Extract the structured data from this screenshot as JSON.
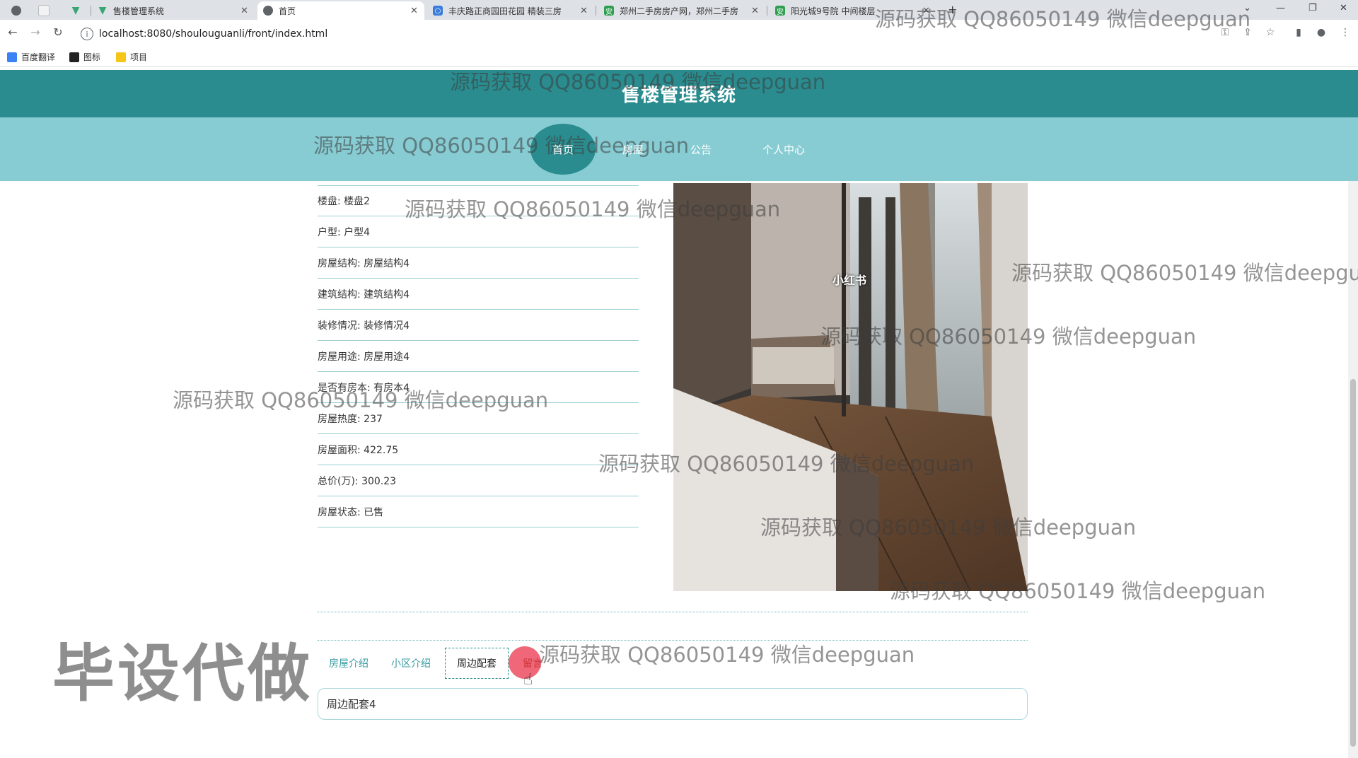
{
  "browser": {
    "tabs": [
      {
        "label": "",
        "active": false
      },
      {
        "label": "",
        "active": false
      },
      {
        "label": "售楼管理系统",
        "active": false
      },
      {
        "label": "首页",
        "active": true
      },
      {
        "label": "丰庆路正商园田花园 精装三房",
        "active": false
      },
      {
        "label": "郑州二手房房产网，郑州二手房",
        "active": false
      },
      {
        "label": "阳光城9号院 中间楼层",
        "active": false
      }
    ],
    "url": "localhost:8080/shoulouguanli/front/index.html",
    "bookmarks": [
      "百度翻译",
      "图标",
      "项目"
    ]
  },
  "site": {
    "title": "售楼管理系统",
    "nav": [
      "首页",
      "房屋",
      "公告",
      "个人中心"
    ]
  },
  "details": [
    "楼盘: 楼盘2",
    "户型: 户型4",
    "房屋结构: 房屋结构4",
    "建筑结构: 建筑结构4",
    "装修情况: 装修情况4",
    "房屋用途: 房屋用途4",
    "是否有房本: 有房本4",
    "房屋热度: 237",
    "房屋面积: 422.75",
    "总价(万): 300.23",
    "房屋状态: 已售"
  ],
  "photo": {
    "label": "小红书"
  },
  "detail_tabs": [
    "房屋介绍",
    "小区介绍",
    "周边配套",
    "留言"
  ],
  "tab_content": "周边配套4",
  "watermarks": {
    "text": "源码获取 QQ86050149 微信deepguan",
    "big": "毕设代做"
  },
  "colors": {
    "header": "#2a8c8f",
    "nav": "#87ccd3",
    "accent": "#3a9ca2"
  }
}
